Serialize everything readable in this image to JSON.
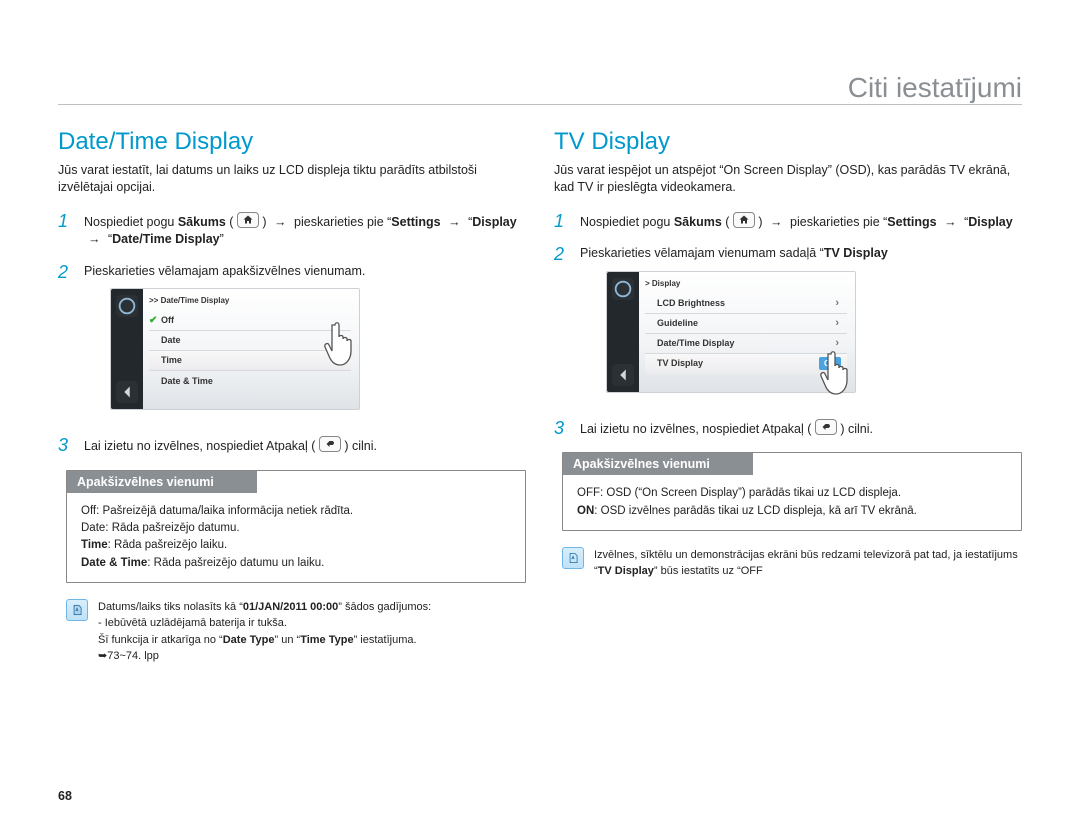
{
  "page_number": "68",
  "header": {
    "title": "Citi iestatījumi"
  },
  "left": {
    "section": "Date/Time Display",
    "intro": "Jūs varat iestatīt, lai datums un laiks uz LCD displeja tiktu parādīts atbilstoši izvēlētajai opcijai.",
    "step1_a": "Nospiediet pogu ",
    "step1_b": "Sākums",
    "step1_c": " pieskarieties pie “",
    "step1_d": "Settings",
    "step1_e": "Display",
    "step1_f": "Date/Time Display",
    "step2": "Pieskarieties vēlamajam apakšizvēlnes vienumam.",
    "step3_a": "Lai izietu no izvēlnes, nospiediet Atpakaļ (",
    "step3_b": ") cilni.",
    "screen": {
      "breadcrumb": ">> Date/Time Display",
      "items": [
        "Off",
        "Date",
        "Time",
        "Date & Time"
      ],
      "checked_index": 0,
      "selected_index": 2
    },
    "sub": {
      "title": "Apakšizvēlnes vienumi",
      "rows": [
        {
          "pre": "Off: ",
          "text": "Pašreizējā datuma/laika informācija netiek rādīta."
        },
        {
          "pre": "Date: ",
          "text": "Rāda pašreizējo datumu."
        },
        {
          "bold": "Time",
          "colon": ": ",
          "text": "Rāda pašreizējo laiku."
        },
        {
          "bold": "Date & Time",
          "colon": ": ",
          "text": "Rāda pašreizējo datumu un laiku."
        }
      ]
    },
    "note": {
      "l1a": "Datums/laiks tiks nolasīts kā “",
      "l1b": "01/JAN/2011 00:00",
      "l1c": "” šādos gadījumos:",
      "l2": "- Iebūvētā uzlādējamā baterija ir tukša.",
      "l3a": "Šī funkcija ir atkarīga no “",
      "l3b": "Date Type",
      "l3c": "” un “",
      "l3d": "Time Type",
      "l3e": "” iestatījuma.",
      "l4": "➥73~74. lpp"
    }
  },
  "right": {
    "section": "TV Display",
    "intro": "Jūs varat iespējot un atspējot “On Screen Display” (OSD), kas parādās TV ekrānā, kad TV ir pieslēgta videokamera.",
    "step1_a": "Nospiediet pogu ",
    "step1_b": "Sākums",
    "step1_c": " pieskarieties pie “",
    "step1_d": "Settings",
    "step1_e": "Display",
    "step2_a": "Pieskarieties vēlamajam vienumam sadaļā “",
    "step2_b": "TV Display",
    "step3_a": "Lai izietu no izvēlnes, nospiediet Atpakaļ (",
    "step3_b": ") cilni.",
    "screen": {
      "breadcrumb": ">  Display",
      "items": [
        "LCD Brightness",
        "Guideline",
        "Date/Time Display",
        "TV Display"
      ],
      "selected_index": 3,
      "value": "ON"
    },
    "sub": {
      "title": "Apakšizvēlnes vienumi",
      "rows": [
        {
          "pre": "OFF: ",
          "text": "OSD (“On Screen Display”) parādās tikai uz LCD displeja."
        },
        {
          "bold": "ON",
          "colon": ": ",
          "text": "OSD izvēlnes parādās tikai uz LCD displeja, kā arī TV ekrānā."
        }
      ]
    },
    "note": {
      "l1": "Izvēlnes, sīktēlu un demonstrācijas ekrāni būs redzami televizorā pat tad, ja iestatījums “",
      "l2": "TV Display",
      "l3": "” būs iestatīts uz “OFF"
    }
  },
  "glyphs": {
    "arrow": "→",
    "quote_close": "”"
  }
}
